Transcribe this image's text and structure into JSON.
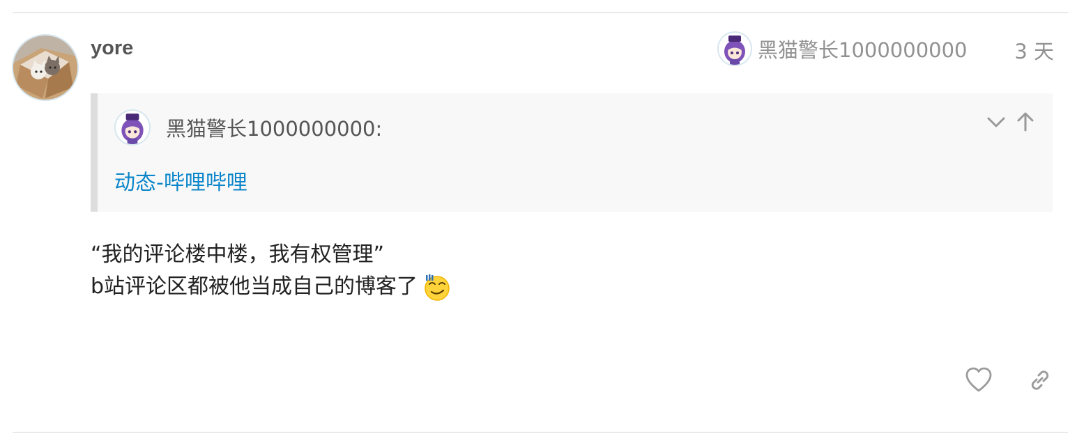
{
  "post": {
    "author": "yore",
    "author_avatar_icon": "cats-in-box-avatar",
    "reply_to": {
      "name": "黑猫警长1000000000",
      "avatar_icon": "anime-girl-avatar"
    },
    "date": "3 天"
  },
  "quote": {
    "author": "黑猫警长1000000000:",
    "link_text": "动态-哔哩哔哩",
    "controls": [
      "chevron-down-icon",
      "arrow-up-icon"
    ]
  },
  "body": {
    "line1": "“我的评论楼中楼，我有权管理”",
    "line2": "b站评论区都被他当成自己的博客了",
    "emoji": "smirk-emoji-icon"
  },
  "actions": [
    "heart-icon",
    "link-icon"
  ],
  "colors": {
    "link": "#0a85c9",
    "muted": "#919191",
    "quote_bg": "#f8f8f8",
    "quote_border": "#dddddd"
  }
}
